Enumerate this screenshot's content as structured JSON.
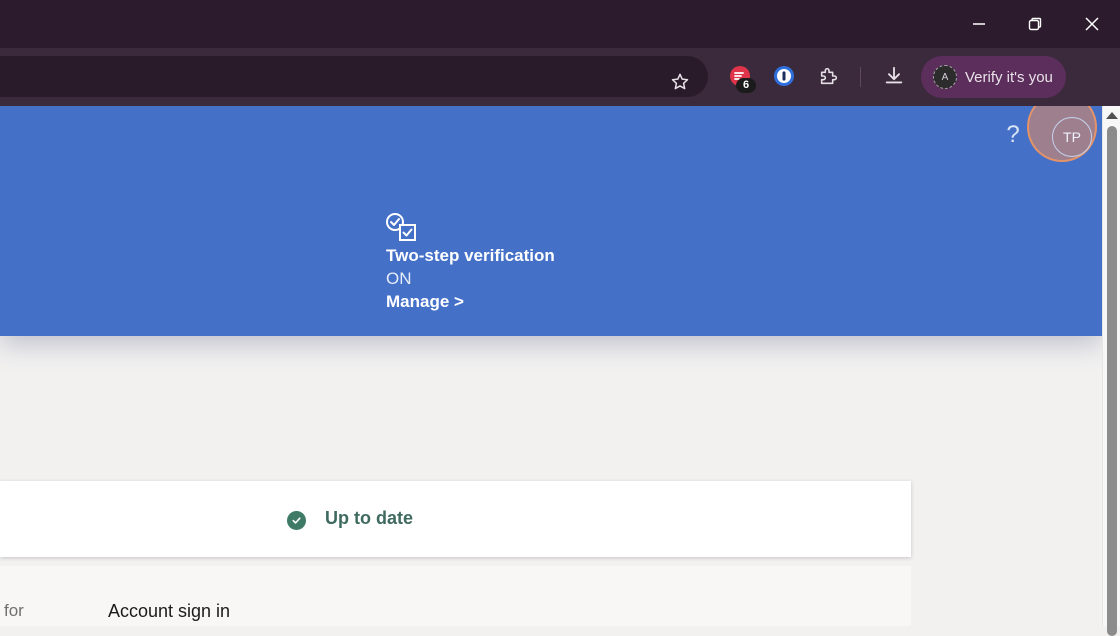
{
  "browser": {
    "window_controls": {
      "minimize_icon": "minimize-icon",
      "restore_icon": "restore-icon",
      "close_icon": "close-icon"
    },
    "toolbar": {
      "extension_badge_count": "6",
      "profile_avatar_initial": "A",
      "verify_label": "Verify it's you"
    }
  },
  "page": {
    "header": {
      "help_label": "?",
      "user_initials": "TP"
    },
    "two_step": {
      "title": "Two-step verification",
      "status": "ON",
      "manage_label": "Manage >"
    },
    "status_card": {
      "label": "Up to date"
    },
    "lower": {
      "left_fragment": "for",
      "account_signin": "Account sign in"
    }
  },
  "colors": {
    "hero_blue": "#4470c8",
    "status_green": "#3f7a66",
    "titlebar": "#2b1b2c",
    "toolbar": "#3b2a3c",
    "verify_pill": "#5c2e5c",
    "highlight_ring": "#e98c5f"
  }
}
